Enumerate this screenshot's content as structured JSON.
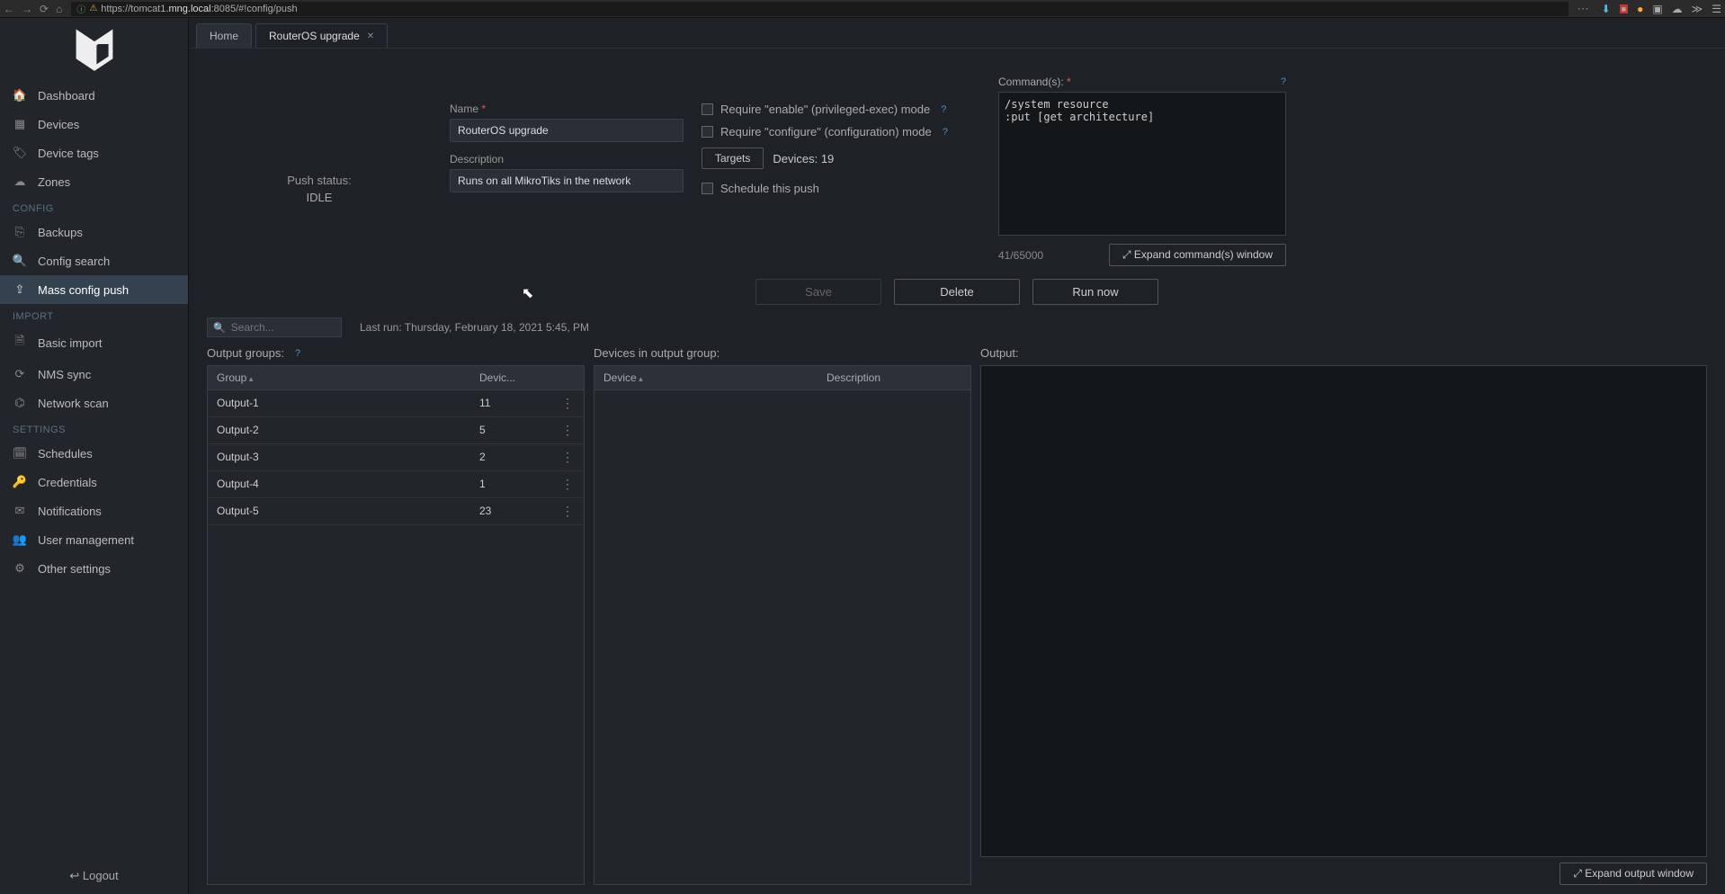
{
  "browser": {
    "url_prefix": "https://tomcat1",
    "url_domain": ".mng.local",
    "url_suffix": ":8085/#!config/push"
  },
  "sidebar": {
    "sections": [
      {
        "label": "",
        "items": [
          {
            "icon": "tachometer",
            "label": "Dashboard"
          },
          {
            "icon": "grid",
            "label": "Devices"
          },
          {
            "icon": "tags",
            "label": "Device tags"
          },
          {
            "icon": "cloud",
            "label": "Zones"
          }
        ]
      },
      {
        "label": "CONFIG",
        "items": [
          {
            "icon": "copy",
            "label": "Backups"
          },
          {
            "icon": "search",
            "label": "Config search"
          },
          {
            "icon": "upload",
            "label": "Mass config push",
            "active": true
          }
        ]
      },
      {
        "label": "IMPORT",
        "items": [
          {
            "icon": "file",
            "label": "Basic import"
          },
          {
            "icon": "refresh",
            "label": "NMS sync"
          },
          {
            "icon": "sitemap",
            "label": "Network scan"
          }
        ]
      },
      {
        "label": "SETTINGS",
        "items": [
          {
            "icon": "calendar",
            "label": "Schedules"
          },
          {
            "icon": "key",
            "label": "Credentials"
          },
          {
            "icon": "mail",
            "label": "Notifications"
          },
          {
            "icon": "users",
            "label": "User management"
          },
          {
            "icon": "cogs",
            "label": "Other settings"
          }
        ]
      }
    ],
    "logout": "Logout"
  },
  "tabs": [
    {
      "label": "Home",
      "closable": false,
      "active": false
    },
    {
      "label": "RouterOS upgrade",
      "closable": true,
      "active": true
    }
  ],
  "push_status": {
    "label": "Push status:",
    "value": "IDLE"
  },
  "form": {
    "name_label": "Name",
    "name_value": "RouterOS upgrade",
    "desc_label": "Description",
    "desc_value": "Runs on all MikroTiks in the network"
  },
  "options": {
    "enable_mode": "Require \"enable\" (privileged-exec) mode",
    "configure_mode": "Require \"configure\" (configuration) mode",
    "targets_btn": "Targets",
    "devices_count": "Devices: 19",
    "schedule": "Schedule this push"
  },
  "commands": {
    "label": "Command(s):",
    "text": "/system resource\n:put [get architecture]",
    "char_count": "41/65000",
    "expand": "Expand command(s) window"
  },
  "actions": {
    "save": "Save",
    "delete": "Delete",
    "run": "Run now"
  },
  "search": {
    "placeholder": "Search..."
  },
  "last_run": "Last run: Thursday, February 18, 2021 5:45, PM",
  "panels": {
    "groups_label": "Output groups:",
    "devices_label": "Devices in output group:",
    "output_label": "Output:"
  },
  "groups_table": {
    "headers": {
      "group": "Group",
      "devices": "Devic..."
    },
    "rows": [
      {
        "name": "Output-1",
        "count": "11"
      },
      {
        "name": "Output-2",
        "count": "5"
      },
      {
        "name": "Output-3",
        "count": "2"
      },
      {
        "name": "Output-4",
        "count": "1"
      },
      {
        "name": "Output-5",
        "count": "23"
      }
    ]
  },
  "devices_table": {
    "headers": {
      "device": "Device",
      "desc": "Description"
    }
  },
  "output_footer": {
    "expand": "Expand output window"
  },
  "icons": {
    "tachometer": "🏠",
    "grid": "▦",
    "tags": "🏷",
    "cloud": "☁",
    "copy": "⎘",
    "search": "🔍",
    "upload": "⇪",
    "file": "🗎",
    "refresh": "⟳",
    "sitemap": "⌬",
    "calendar": "🗓",
    "key": "🔑",
    "mail": "✉",
    "users": "👥",
    "cogs": "⚙"
  }
}
